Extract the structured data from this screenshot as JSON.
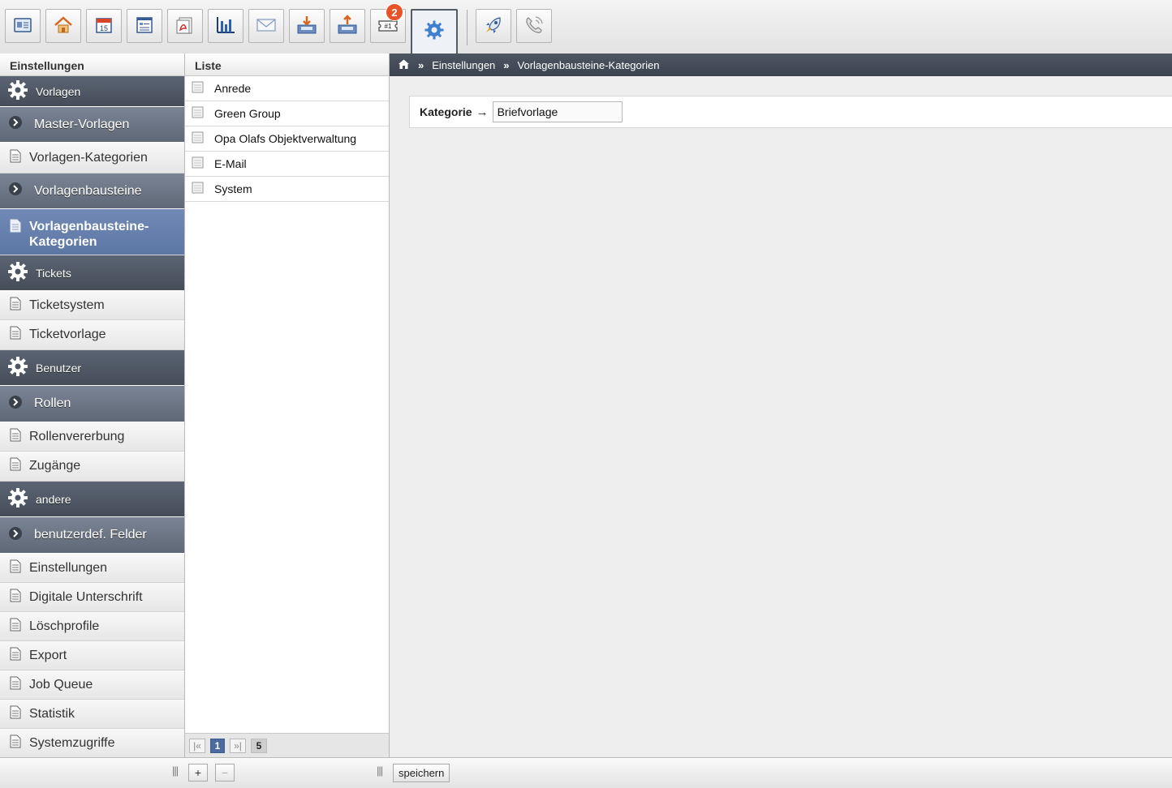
{
  "toolbar": {
    "buttons": [
      {
        "icon": "contact-card-icon"
      },
      {
        "icon": "home-icon"
      },
      {
        "icon": "calendar-icon",
        "text": "15"
      },
      {
        "icon": "document-list-icon"
      },
      {
        "icon": "pdf-document-icon"
      },
      {
        "icon": "bar-chart-icon"
      },
      {
        "icon": "envelope-icon"
      },
      {
        "icon": "inbox-download-icon"
      },
      {
        "icon": "outbox-upload-icon"
      },
      {
        "icon": "ticket-icon",
        "text": "#1",
        "badge": "2"
      },
      {
        "icon": "settings-gear-icon",
        "active": true
      },
      {
        "icon": "rocket-icon"
      },
      {
        "icon": "phone-icon"
      }
    ]
  },
  "headers": {
    "nav": "Einstellungen",
    "list": "Liste"
  },
  "breadcrumb": {
    "items": [
      "Einstellungen",
      "Vorlagenbausteine-Kategorien"
    ],
    "separator": "»"
  },
  "nav": {
    "items": [
      {
        "type": "section",
        "label": "Vorlagen"
      },
      {
        "type": "sub",
        "label": "Master-Vorlagen"
      },
      {
        "type": "leaf",
        "label": "Vorlagen-Kategorien"
      },
      {
        "type": "sub",
        "label": "Vorlagenbausteine"
      },
      {
        "type": "leaf",
        "label": "Vorlagenbausteine-Kategorien",
        "selected": true
      },
      {
        "type": "section",
        "label": "Tickets"
      },
      {
        "type": "leaf",
        "label": "Ticketsystem"
      },
      {
        "type": "leaf",
        "label": "Ticketvorlage"
      },
      {
        "type": "section",
        "label": "Benutzer"
      },
      {
        "type": "sub",
        "label": "Rollen"
      },
      {
        "type": "leaf",
        "label": "Rollenvererbung"
      },
      {
        "type": "leaf",
        "label": "Zugänge"
      },
      {
        "type": "section",
        "label": "andere"
      },
      {
        "type": "sub",
        "label": "benutzerdef. Felder"
      },
      {
        "type": "leaf",
        "label": "Einstellungen"
      },
      {
        "type": "leaf",
        "label": "Digitale Unterschrift"
      },
      {
        "type": "leaf",
        "label": "Löschprofile"
      },
      {
        "type": "leaf",
        "label": "Export"
      },
      {
        "type": "leaf",
        "label": "Job Queue"
      },
      {
        "type": "leaf",
        "label": "Statistik"
      },
      {
        "type": "leaf",
        "label": "Systemzugriffe"
      }
    ]
  },
  "list": {
    "rows": [
      "Anrede",
      "Green Group",
      "Opa Olafs Objektverwaltung",
      "E-Mail",
      "System"
    ]
  },
  "pager": {
    "first": "|«",
    "current": "1",
    "last": "»|",
    "total": "5"
  },
  "list_footer": {
    "add": "+",
    "remove": "−"
  },
  "form": {
    "label": "Kategorie",
    "arrow": "→",
    "value": "Briefvorlage"
  },
  "footer": {
    "save_label": "speichern",
    "grip": "|||"
  },
  "colors": {
    "section_bg": "#4d5563",
    "sub_bg": "#6c7584",
    "selected_bg": "#6680ad",
    "badge": "#e8532a",
    "pager_current": "#4b6aa0"
  }
}
